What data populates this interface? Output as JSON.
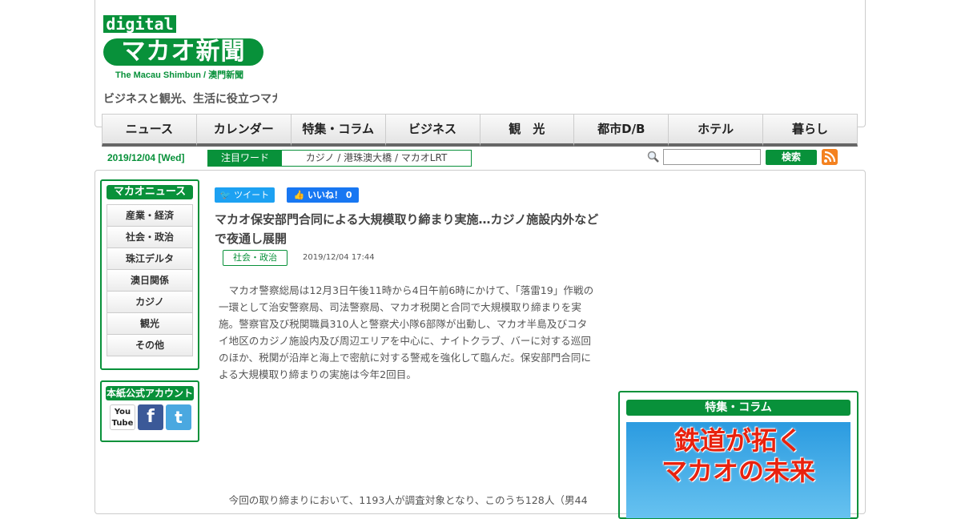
{
  "logo": {
    "digital": "digital",
    "main": "マカオ新聞",
    "sub": "The Macau Shimbun / 澳門新聞"
  },
  "tagline": "ビジネスと観光、生活に役立つマカオ",
  "nav": [
    "ニュース",
    "カレンダー",
    "特集・コラム",
    "ビジネス",
    "観　光",
    "都市D/B",
    "ホテル",
    "暮らし"
  ],
  "date": "2019/12/04 [Wed]",
  "hot": {
    "label": "注目ワード",
    "words": "カジノ / 港珠澳大橋 / マカオLRT"
  },
  "search": {
    "button": "検索",
    "value": ""
  },
  "sidebar": {
    "title": "マカオニュース",
    "items": [
      "産業・経済",
      "社会・政治",
      "珠江デルタ",
      "澳日関係",
      "カジノ",
      "観光",
      "その他"
    ],
    "social_title": "本紙公式アカウント",
    "social": [
      "You Tube",
      "f",
      "t"
    ]
  },
  "share": {
    "tweet": "ツイート",
    "like": "いいね！ 0"
  },
  "article": {
    "title": "マカオ保安部門合同による大規模取り締まり実施…カジノ施設内外などで夜通し展開",
    "category": "社会・政治",
    "timestamp": "2019/12/04 17:44",
    "paragraph1": "マカオ警察総局は12月3日午後11時から4日午前6時にかけて、「落雷19」作戦の一環として治安警察局、司法警察局、マカオ税関と合同で大規模取り締まりを実施。警察官及び税関職員310人と警察犬小隊6部隊が出動し、マカオ半島及びコタイ地区のカジノ施設内及び周辺エリアを中心に、ナイトクラブ、バーに対する巡回のほか、税関が沿岸と海上で密航に対する警戒を強化して臨んだ。保安部門合同による大規模取り締まりの実施は今年2回目。",
    "paragraph2": "今回の取り締まりにおいて、1193人が調査対象となり、このうち128人（男44"
  },
  "feature": {
    "title": "特集・コラム",
    "banner_line1": "鉄道が拓く",
    "banner_line2": "マカオの未来"
  },
  "colors": {
    "accent": "#08913a",
    "twitter": "#1da1f2",
    "facebook": "#1877f2",
    "rss": "#f48220"
  }
}
